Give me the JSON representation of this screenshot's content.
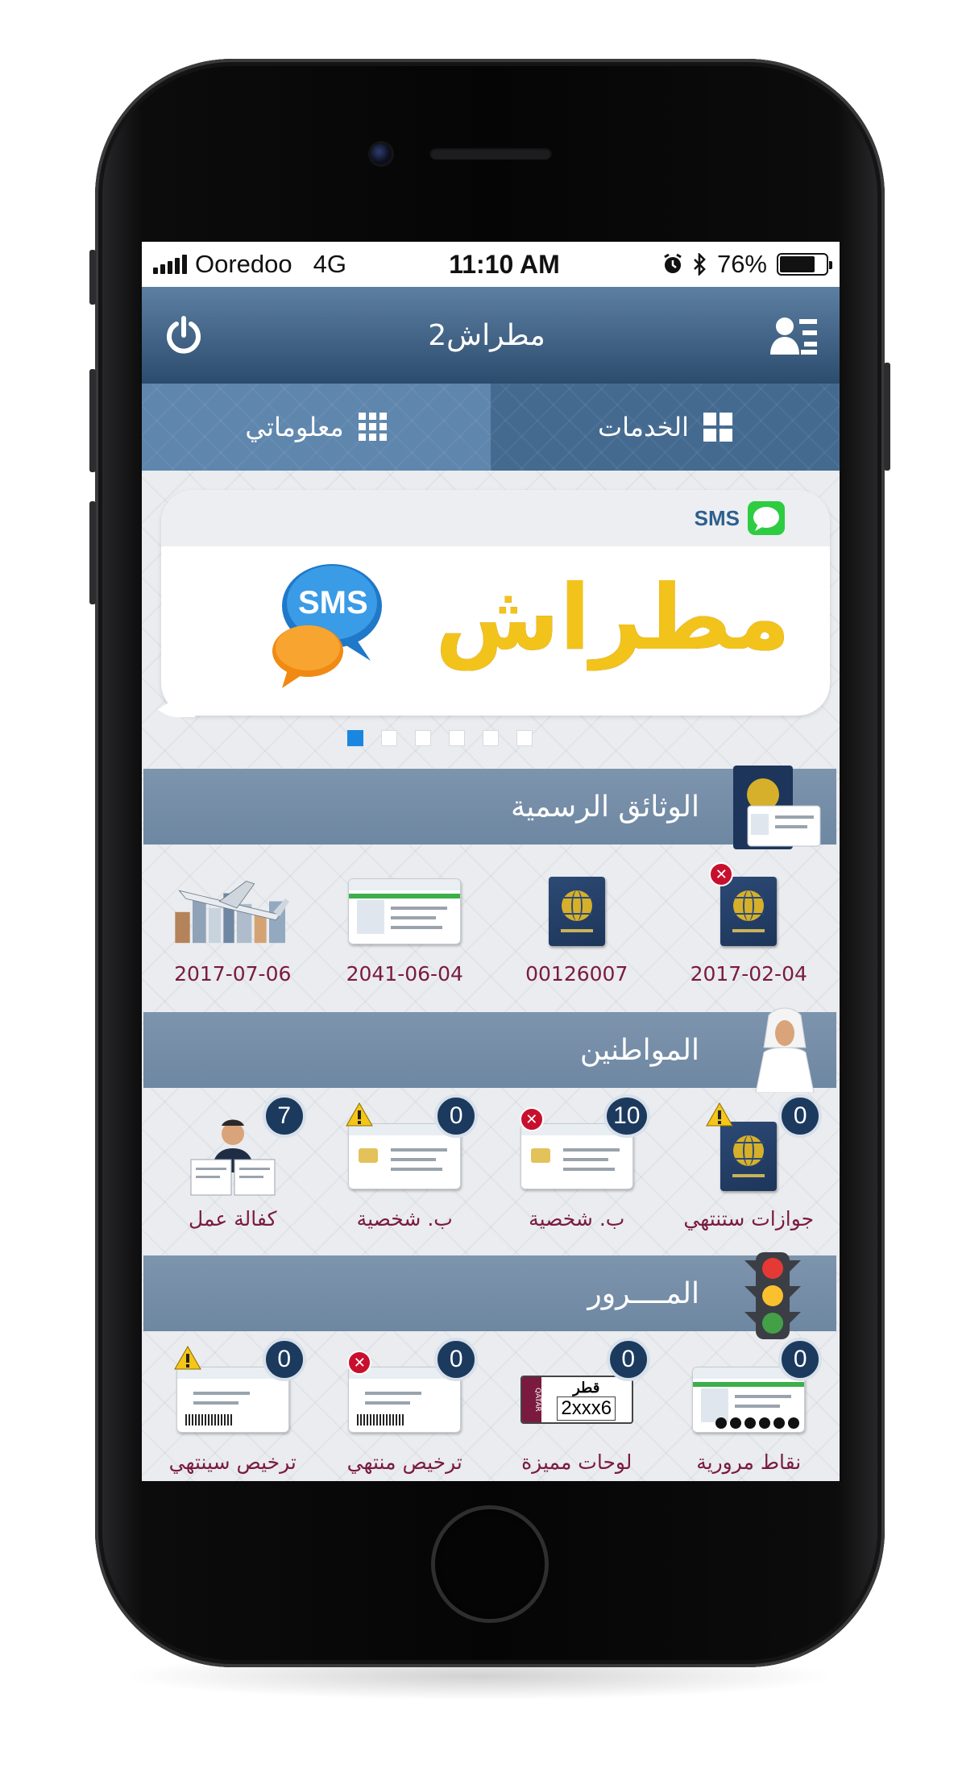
{
  "status_bar": {
    "carrier": "Ooredoo",
    "network": "4G",
    "time": "11:10 AM",
    "battery": "76%",
    "battery_level": 0.76
  },
  "header": {
    "title": "مطراش2"
  },
  "tabs": [
    {
      "label": "معلوماتي",
      "icon": "grid-icon"
    },
    {
      "label": "الخدمات",
      "icon": "windows-icon"
    }
  ],
  "banner": {
    "sms_tag": "SMS",
    "bubble_text": "SMS",
    "logo_text": "مطراش",
    "slide_count": 6,
    "active_slide": 0
  },
  "sections": {
    "documents": {
      "title": "الوثائق الرسمية",
      "items": [
        {
          "label": "2017-02-04",
          "icon": "passport-expired-icon"
        },
        {
          "label": "00126007",
          "icon": "passport-icon"
        },
        {
          "label": "2041-06-04",
          "icon": "id-card-icon"
        },
        {
          "label": "2017-07-06",
          "icon": "airplane-city-icon"
        }
      ]
    },
    "citizens": {
      "title": "المواطنين",
      "items": [
        {
          "label": "جوازات ستنتهي",
          "count": "0",
          "icon": "passport-warning-icon"
        },
        {
          "label": "ب. شخصية",
          "count": "10",
          "icon": "id-card-expired-icon"
        },
        {
          "label": "ب. شخصية",
          "count": "0",
          "icon": "id-card-warning-icon"
        },
        {
          "label": "كفالة عمل",
          "count": "7",
          "icon": "sponsor-icon"
        }
      ]
    },
    "traffic": {
      "title": "المــــرور",
      "items": [
        {
          "label": "نقاط مرورية",
          "count": "0",
          "icon": "license-points-icon"
        },
        {
          "label": "لوحات مميزة",
          "count": "0",
          "icon": "license-plate-icon",
          "plate_top": "قطر",
          "plate_number": "2xxx6",
          "plate_side": "QATAR"
        },
        {
          "label": "ترخيص منتهي",
          "count": "0",
          "icon": "registration-expired-icon"
        },
        {
          "label": "ترخيص سينتهي",
          "count": "0",
          "icon": "registration-warning-icon"
        }
      ]
    }
  }
}
